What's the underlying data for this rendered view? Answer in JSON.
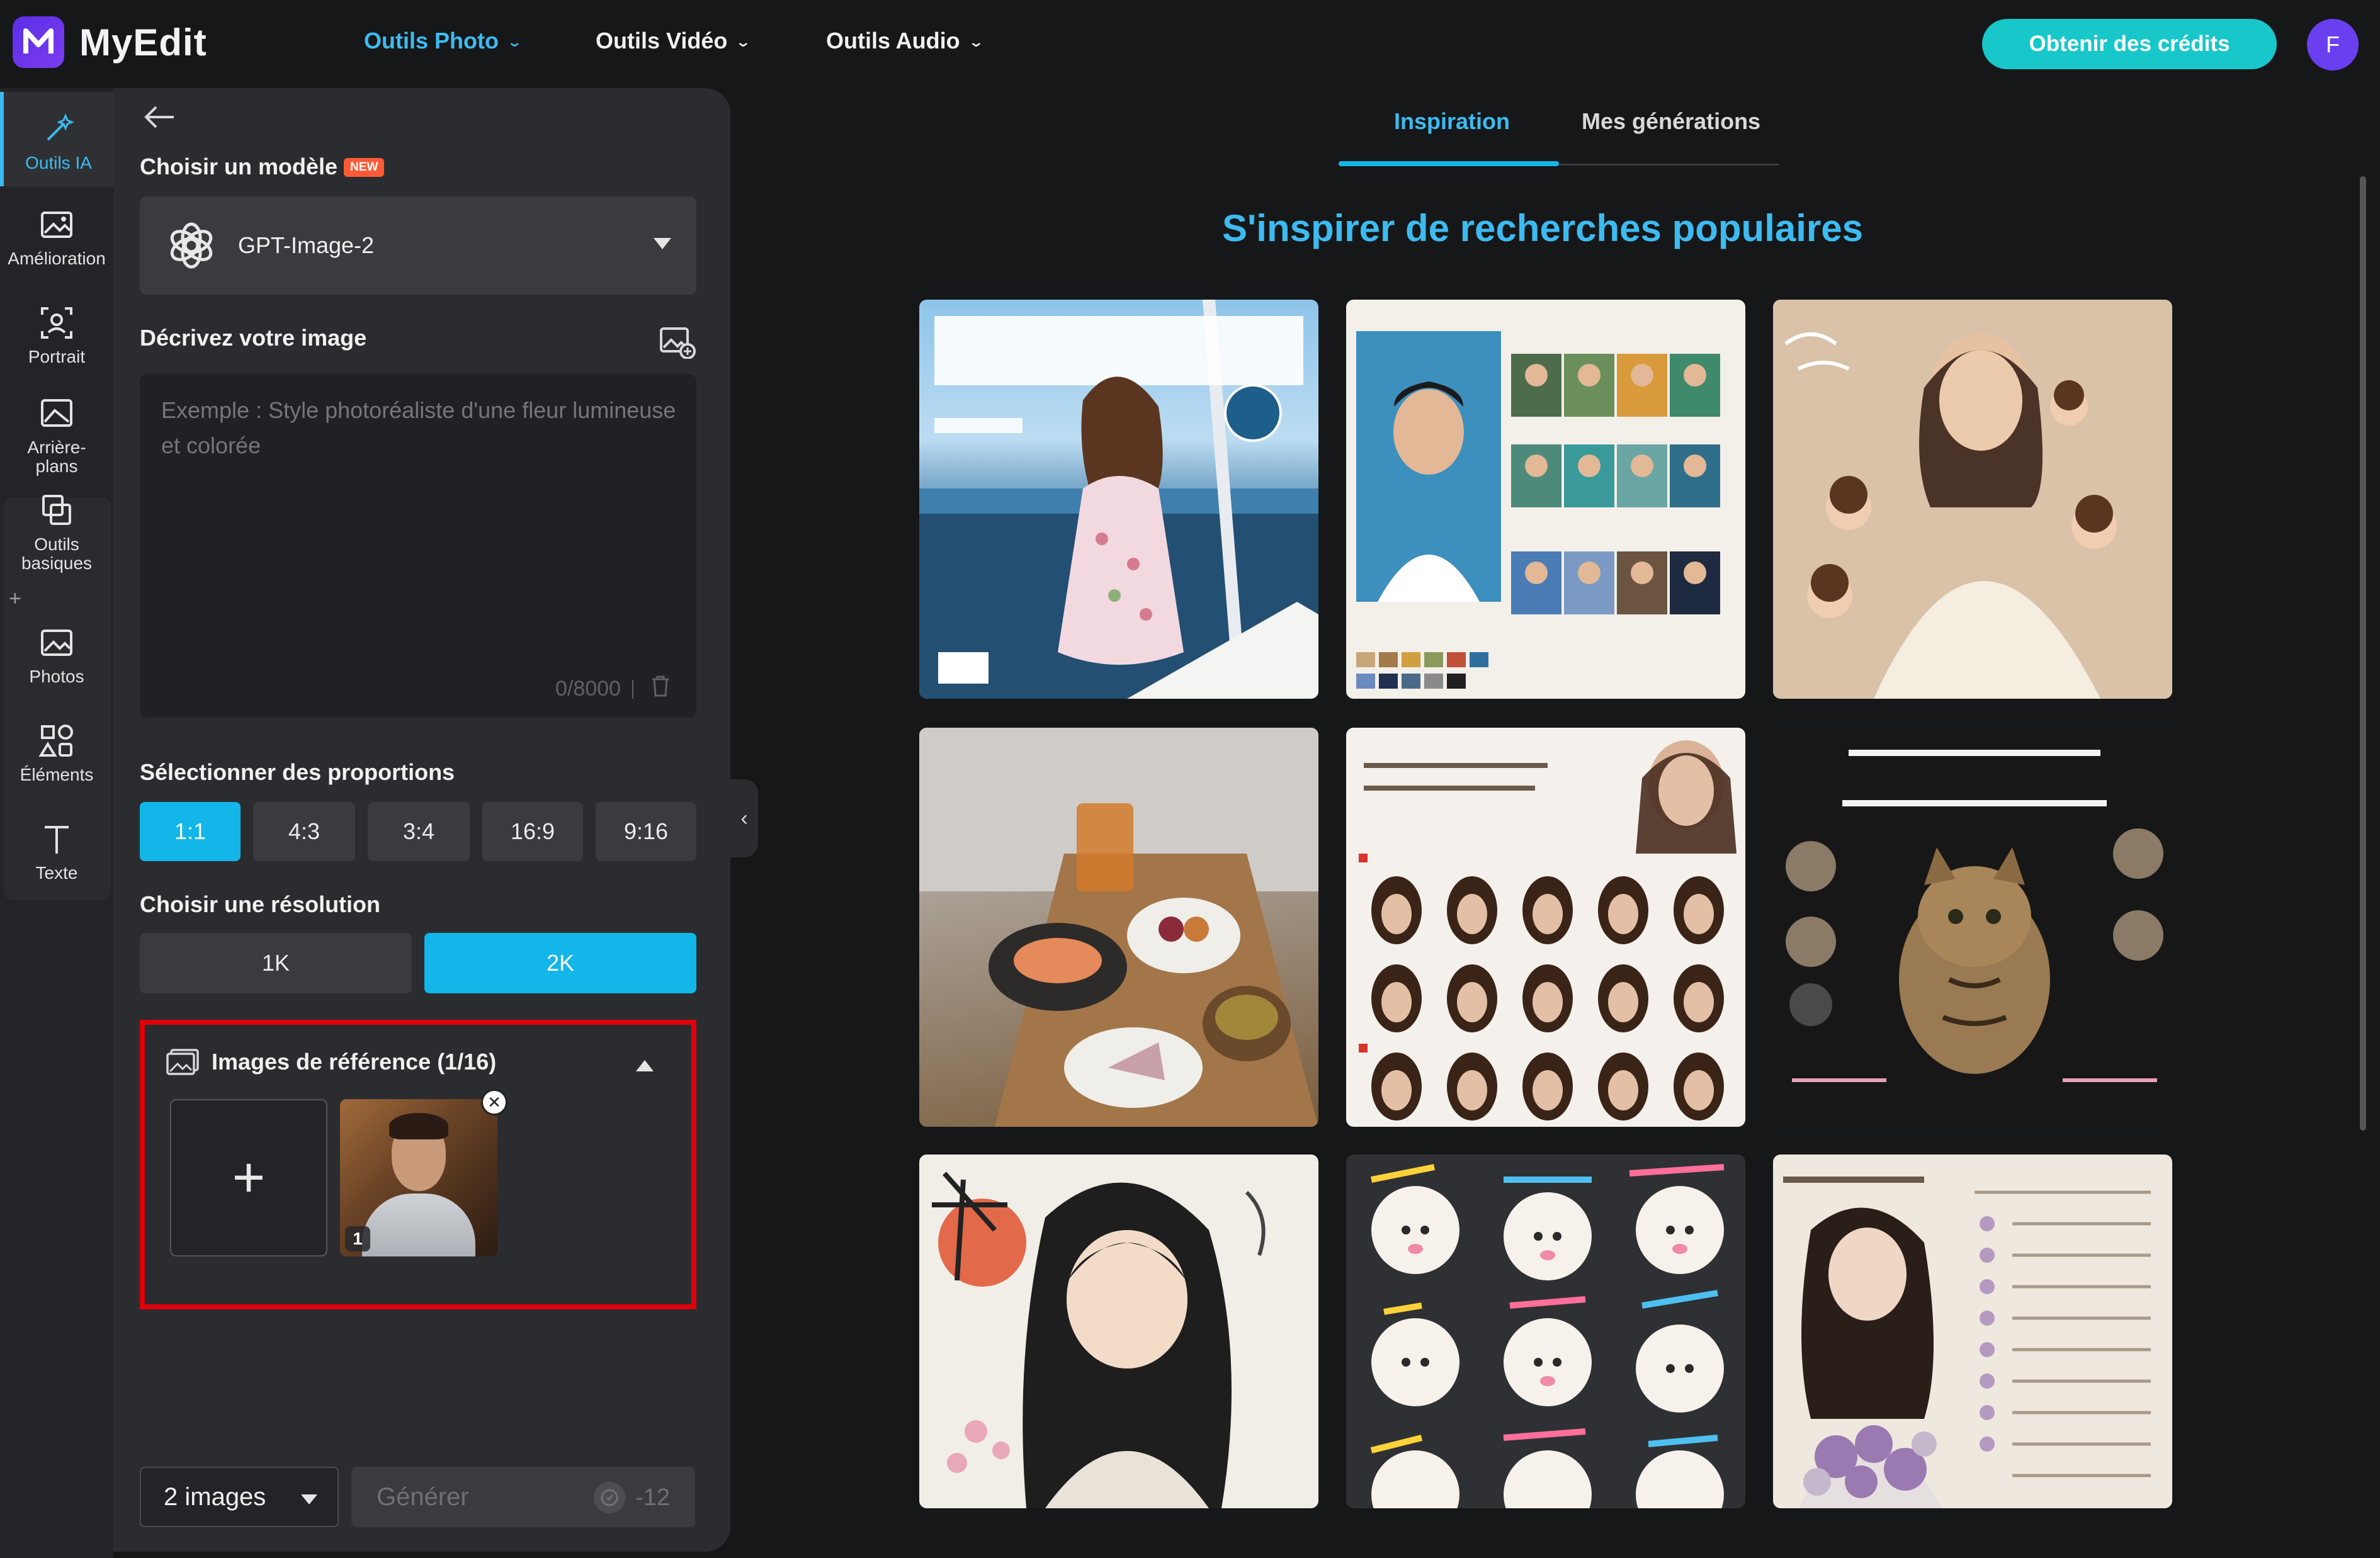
{
  "brand": {
    "name": "MyEdit",
    "avatar_initial": "F"
  },
  "topnav": {
    "photo": "Outils Photo",
    "video": "Outils Vidéo",
    "audio": "Outils Audio",
    "credits_button": "Obtenir des crédits"
  },
  "rail": {
    "items": [
      {
        "label": "Outils IA"
      },
      {
        "label": "Amélioration"
      },
      {
        "label": "Portrait"
      },
      {
        "label": "Arrière-plans"
      },
      {
        "label": "Outils basiques"
      },
      {
        "label": "Photos"
      },
      {
        "label": "Éléments"
      },
      {
        "label": "Texte"
      }
    ]
  },
  "panel": {
    "model_title": "Choisir un modèle",
    "new_badge": "NEW",
    "model_value": "GPT-Image-2",
    "describe_title": "Décrivez votre image",
    "prompt_placeholder": "Exemple : Style photoréaliste d'une fleur lumineuse et colorée",
    "char_count": "0/8000",
    "ratio_title": "Sélectionner des proportions",
    "ratios": [
      "1:1",
      "4:3",
      "3:4",
      "16:9",
      "9:16"
    ],
    "ratio_selected": "1:1",
    "resolution_title": "Choisir une résolution",
    "resolutions": [
      "1K",
      "2K"
    ],
    "resolution_selected": "2K",
    "reference_title": "Images de référence (1/16)",
    "reference_add": "+",
    "reference_index": "1",
    "count_value": "2 images",
    "generate_label": "Générer",
    "generate_cost": "-12"
  },
  "main": {
    "tabs": [
      "Inspiration",
      "Mes générations"
    ],
    "active_tab": "Inspiration",
    "heading": "S'inspirer de recherches populaires"
  },
  "colors": {
    "accent": "#13b6e8",
    "credits": "#17c7c9",
    "highlight_border": "#e0000b",
    "brand": "#5b2ee6"
  }
}
